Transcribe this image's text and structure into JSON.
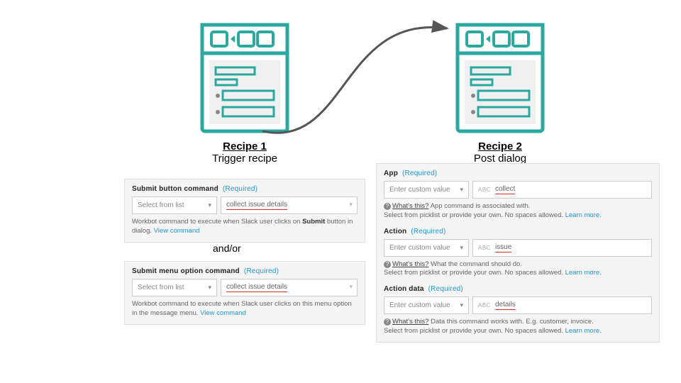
{
  "headings": {
    "recipe1_title": "Recipe 1",
    "recipe1_sub": "Trigger recipe",
    "recipe2_title": "Recipe 2",
    "recipe2_sub": "Post dialog",
    "andor": "and/or"
  },
  "common": {
    "required": "(Required)",
    "select_from_list": "Select from list",
    "enter_custom_value": "Enter custom value",
    "abc": "ABC",
    "learn_more": "Learn more.",
    "whats_this": "What's this?",
    "view_command": "View command"
  },
  "panel1": {
    "label": "Submit button command",
    "value": "collect issue details",
    "caption_pre": "Workbot command to execute when Slack user clicks on ",
    "caption_bold": "Submit",
    "caption_post": " button in dialog. "
  },
  "panel2": {
    "label": "Submit menu option command",
    "value": "collect issue details",
    "caption": "Workbot command to execute when Slack user clicks on this menu option in the message menu. "
  },
  "panel3": {
    "app_label": "App",
    "app_value": "collect",
    "app_help": " App command is associated with.",
    "app_caption": "Select from picklist or provide your own. No spaces allowed. ",
    "action_label": "Action",
    "action_value": "issue",
    "action_help": " What the command should do.",
    "action_caption": "Select from picklist or provide your own. No spaces allowed. ",
    "data_label": "Action data",
    "data_value": "details",
    "data_help": " Data this command works with. E.g. customer, invoice.",
    "data_caption": "Select from picklist or provide your own. No spaces allowed. "
  }
}
